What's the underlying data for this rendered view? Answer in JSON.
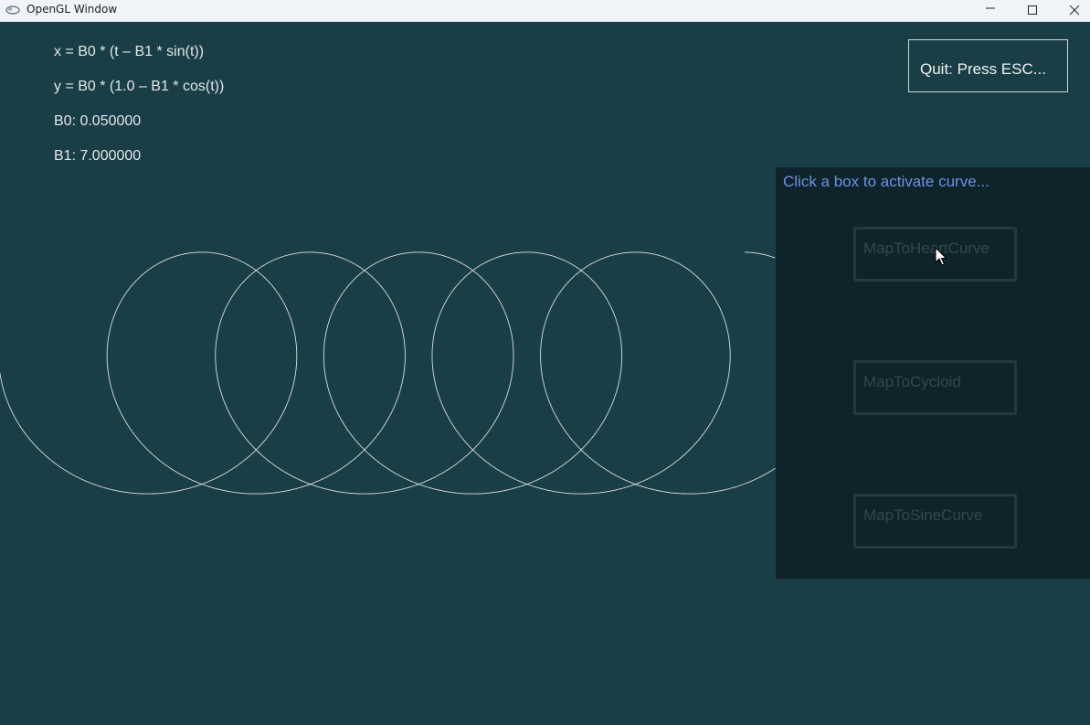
{
  "window": {
    "title": "OpenGL Window"
  },
  "info": {
    "x_equation": "x = B0 * (t – B1 * sin(t))",
    "y_equation": "y = B0 * (1.0 – B1 * cos(t))",
    "b0_text": "B0: 0.050000",
    "b1_text": "B1: 7.000000"
  },
  "quit": {
    "label": "Quit: Press ESC..."
  },
  "panel": {
    "title": "Click a box to activate curve...",
    "buttons": [
      {
        "label": "MapToHeartCurve"
      },
      {
        "label": "MapToCycloid"
      },
      {
        "label": "MapToSineCurve"
      }
    ]
  },
  "colors": {
    "background": "#1a3e46",
    "panel": "#0e232a",
    "panel_title": "#6b94e4",
    "curve": "#d8dde0"
  },
  "curve": {
    "B0": 0.05,
    "B1": 7.0
  }
}
